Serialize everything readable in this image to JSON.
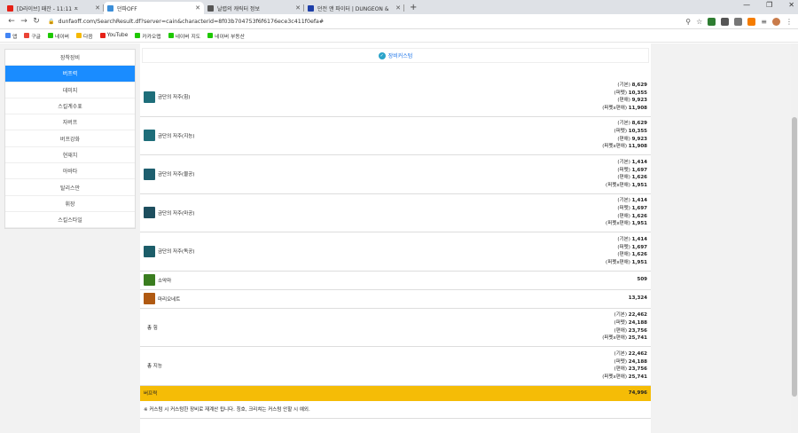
{
  "browser": {
    "tabs": [
      {
        "title": "[D라이브] 패잔 - 11:11 ㅈ",
        "icon_color": "#e62117",
        "active": false
      },
      {
        "title": "던파OFF",
        "icon_color": "#3b8ed8",
        "active": true
      },
      {
        "title": "날렵의 캐릭터 정보",
        "icon_color": "#555555",
        "active": false
      },
      {
        "title": "던전 앤 파이터 | DUNGEON &",
        "icon_color": "#1e3ea8",
        "active": false
      }
    ],
    "new_tab": "+",
    "url": "dunfaoff.com/SearchResult.df?server=cain&characterid=8f03b704753f6f6176ece3c411f0efa#",
    "bookmarks": [
      {
        "label": "앱",
        "color": "#4285f4"
      },
      {
        "label": "구글",
        "color": "#ea4335"
      },
      {
        "label": "네이버",
        "color": "#1ec800"
      },
      {
        "label": "다음",
        "color": "#f5b800"
      },
      {
        "label": "YouTube",
        "color": "#e62117"
      },
      {
        "label": "카카오맵",
        "color": "#1ec800"
      },
      {
        "label": "네이버 지도",
        "color": "#1ec800"
      },
      {
        "label": "네이버 부동산",
        "color": "#1ec800"
      }
    ]
  },
  "sidebar": {
    "items": [
      "장착장비",
      "버프력",
      "데미지",
      "스킬계수표",
      "자버프",
      "버프강화",
      "현재치",
      "아바타",
      "탈리스만",
      "휘장",
      "스킬스타일"
    ],
    "active_index": 1
  },
  "banner": {
    "label": "장비커스텀"
  },
  "rows": [
    {
      "name": "금단의 저주(힘)",
      "icon_color": "#1e6e7a",
      "lines": [
        [
          "(기본)",
          "8,629"
        ],
        [
          "(퍼펫)",
          "10,355"
        ],
        [
          "(편애)",
          "9,923"
        ],
        [
          "(퍼펫x편애)",
          "11,908"
        ]
      ]
    },
    {
      "name": "금단의 저주(지능)",
      "icon_color": "#1e6e7a",
      "lines": [
        [
          "(기본)",
          "8,629"
        ],
        [
          "(퍼펫)",
          "10,355"
        ],
        [
          "(편애)",
          "9,923"
        ],
        [
          "(퍼펫x편애)",
          "11,908"
        ]
      ]
    },
    {
      "name": "금단의 저주(물공)",
      "icon_color": "#1d5e6e",
      "lines": [
        [
          "(기본)",
          "1,414"
        ],
        [
          "(퍼펫)",
          "1,697"
        ],
        [
          "(편애)",
          "1,626"
        ],
        [
          "(퍼펫x편애)",
          "1,951"
        ]
      ]
    },
    {
      "name": "금단의 저주(마공)",
      "icon_color": "#1d4e5e",
      "lines": [
        [
          "(기본)",
          "1,414"
        ],
        [
          "(퍼펫)",
          "1,697"
        ],
        [
          "(편애)",
          "1,626"
        ],
        [
          "(퍼펫x편애)",
          "1,951"
        ]
      ]
    },
    {
      "name": "금단의 저주(독공)",
      "icon_color": "#1c5d69",
      "lines": [
        [
          "(기본)",
          "1,414"
        ],
        [
          "(퍼펫)",
          "1,697"
        ],
        [
          "(편애)",
          "1,626"
        ],
        [
          "(퍼펫x편애)",
          "1,951"
        ]
      ]
    },
    {
      "name": "소악마",
      "icon_color": "#3a7d1f",
      "lines": [
        [
          "",
          "509"
        ]
      ]
    },
    {
      "name": "마리오네트",
      "icon_color": "#b05a12",
      "lines": [
        [
          "",
          "13,324"
        ]
      ]
    },
    {
      "name": "총 힘",
      "icon_color": "",
      "lines": [
        [
          "(기본)",
          "22,462"
        ],
        [
          "(퍼펫)",
          "24,188"
        ],
        [
          "(편애)",
          "23,756"
        ],
        [
          "(퍼펫x편애)",
          "25,741"
        ]
      ]
    },
    {
      "name": "총 지능",
      "icon_color": "",
      "lines": [
        [
          "(기본)",
          "22,462"
        ],
        [
          "(퍼펫)",
          "24,188"
        ],
        [
          "(편애)",
          "23,756"
        ],
        [
          "(퍼펫x편애)",
          "25,741"
        ]
      ]
    }
  ],
  "summary": {
    "label": "버프력",
    "value": "74,996",
    "color": "#f5bc06"
  },
  "note": "※ 커스텀 시 커스텀한 장비로 재계산 됩니다. 칭호, 크리쳐는 커스텀 안할 시 예외."
}
